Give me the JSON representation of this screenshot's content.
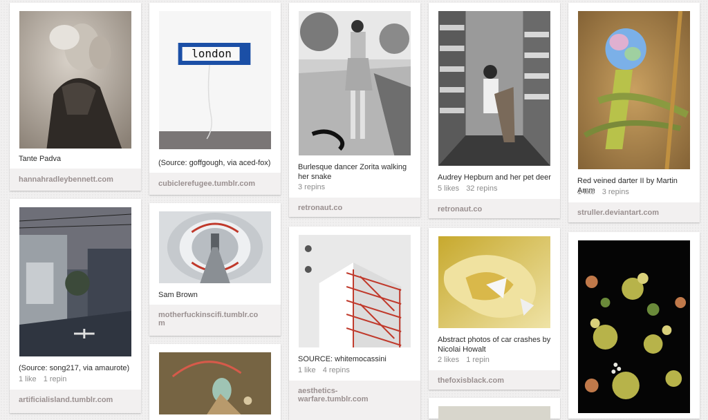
{
  "pins": [
    {
      "id": "tante",
      "description": "Tante Padva",
      "source": "hannahradleybennett.com"
    },
    {
      "id": "london-sign",
      "sign_text": "london",
      "description": "(Source: goffgough, via aced-fox)",
      "source": "cubiclerefugee.tumblr.com"
    },
    {
      "id": "zorita",
      "description": "Burlesque dancer Zorita walking her snake",
      "repins": "3 repins",
      "source": "retronaut.co"
    },
    {
      "id": "hepburn",
      "description": "Audrey Hepburn and her pet deer",
      "likes": "5 likes",
      "repins": "32 repins",
      "source": "retronaut.co"
    },
    {
      "id": "darter",
      "description": "Red veined darter II by Martin Amm",
      "likes": "1 like",
      "repins": "3 repins",
      "source": "struller.deviantart.com"
    },
    {
      "id": "street",
      "description": "(Source: song217, via amaurote)",
      "likes": "1 like",
      "repins": "1 repin",
      "source": "artificialisland.tumblr.com"
    },
    {
      "id": "corridor",
      "description": "Sam Brown",
      "source_line1": "motherfuckinscifi.tumblr.co",
      "source_line2": "m"
    },
    {
      "id": "stairs",
      "description": "SOURCE: whitemocassini",
      "likes": "1 like",
      "repins": "4 repins",
      "source_line1": "aesthetics-",
      "source_line2": "warfare.tumblr.com"
    },
    {
      "id": "crash",
      "description": "Abstract photos of car crashes by Nicolai Howalt",
      "likes": "2 likes",
      "repins": "1 repin",
      "source": "thefoxisblack.com"
    },
    {
      "id": "painting"
    },
    {
      "id": "flowers"
    },
    {
      "id": "partial"
    }
  ]
}
